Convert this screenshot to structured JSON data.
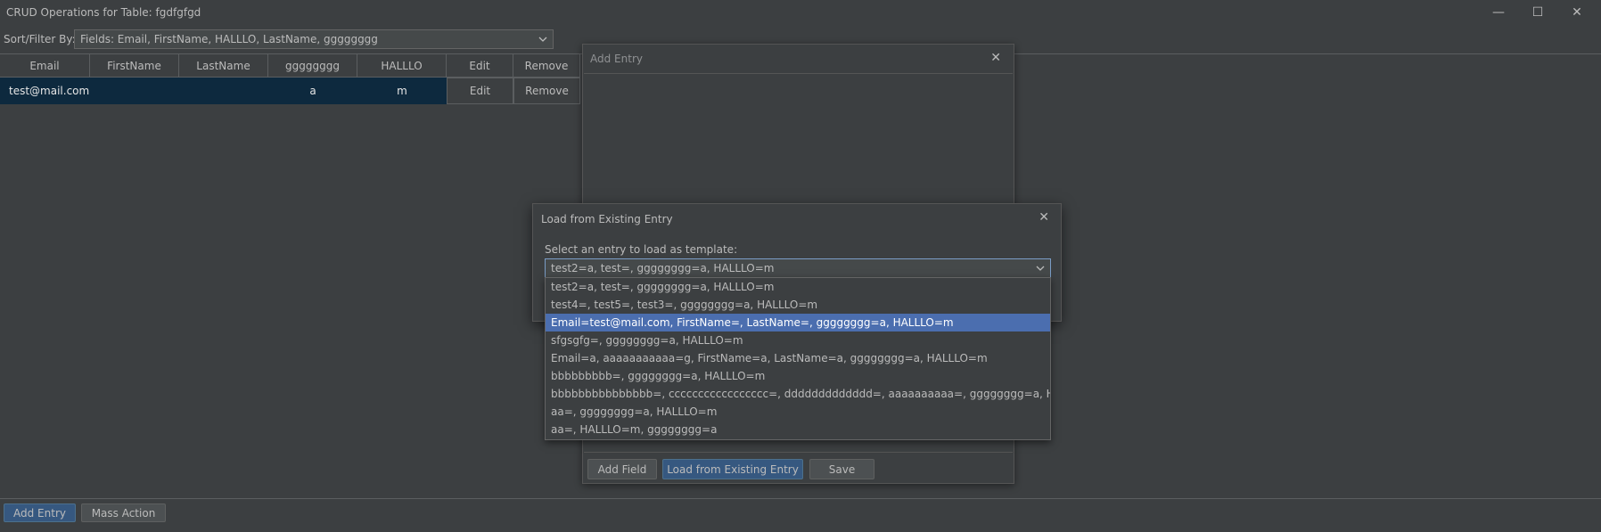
{
  "window": {
    "title": "CRUD Operations for Table: fgdfgfgd",
    "minimize_glyph": "—",
    "maximize_glyph": "☐",
    "close_glyph": "✕"
  },
  "sortbar": {
    "label": "Sort/Filter By:",
    "selected": "Fields: Email, FirstName, HALLLO, LastName, gggggggg"
  },
  "table": {
    "columns": [
      "Email",
      "FirstName",
      "LastName",
      "gggggggg",
      "HALLLO",
      "Edit",
      "Remove"
    ],
    "rows": [
      {
        "email": "test@mail.com",
        "firstname": "",
        "lastname": "",
        "gggggggg": "a",
        "halllo": "m",
        "edit": "Edit",
        "remove": "Remove"
      }
    ]
  },
  "bottom": {
    "add_entry": "Add Entry",
    "mass_action": "Mass Action"
  },
  "add_dialog": {
    "title": "Add Entry",
    "close_glyph": "✕",
    "add_field": "Add Field",
    "load_existing": "Load from Existing Entry",
    "save": "Save"
  },
  "load_dialog": {
    "title": "Load from Existing Entry",
    "close_glyph": "✕",
    "prompt": "Select an entry to load as template:",
    "selected": "test2=a, test=, gggggggg=a, HALLLO=m",
    "options": [
      "test2=a, test=, gggggggg=a, HALLLO=m",
      "test4=, test5=, test3=, gggggggg=a, HALLLO=m",
      "Email=test@mail.com, FirstName=, LastName=, gggggggg=a, HALLLO=m",
      "sfgsgfg=, gggggggg=a, HALLLO=m",
      "Email=a, aaaaaaaaaaa=g, FirstName=a, LastName=a, gggggggg=a, HALLLO=m",
      "bbbbbbbbb=, gggggggg=a, HALLLO=m",
      "bbbbbbbbbbbbbbb=, ccccccccccccccccc=, ddddddddddddd=, aaaaaaaaaa=, gggggggg=a, HALLLO=m",
      "aa=, gggggggg=a, HALLLO=m",
      "aa=, HALLLO=m, gggggggg=a"
    ],
    "highlighted_index": 2
  },
  "colors": {
    "background": "#3c3f41",
    "selection": "#4b6eaf",
    "row_selected": "#0d293e",
    "primary_button": "#365880"
  }
}
